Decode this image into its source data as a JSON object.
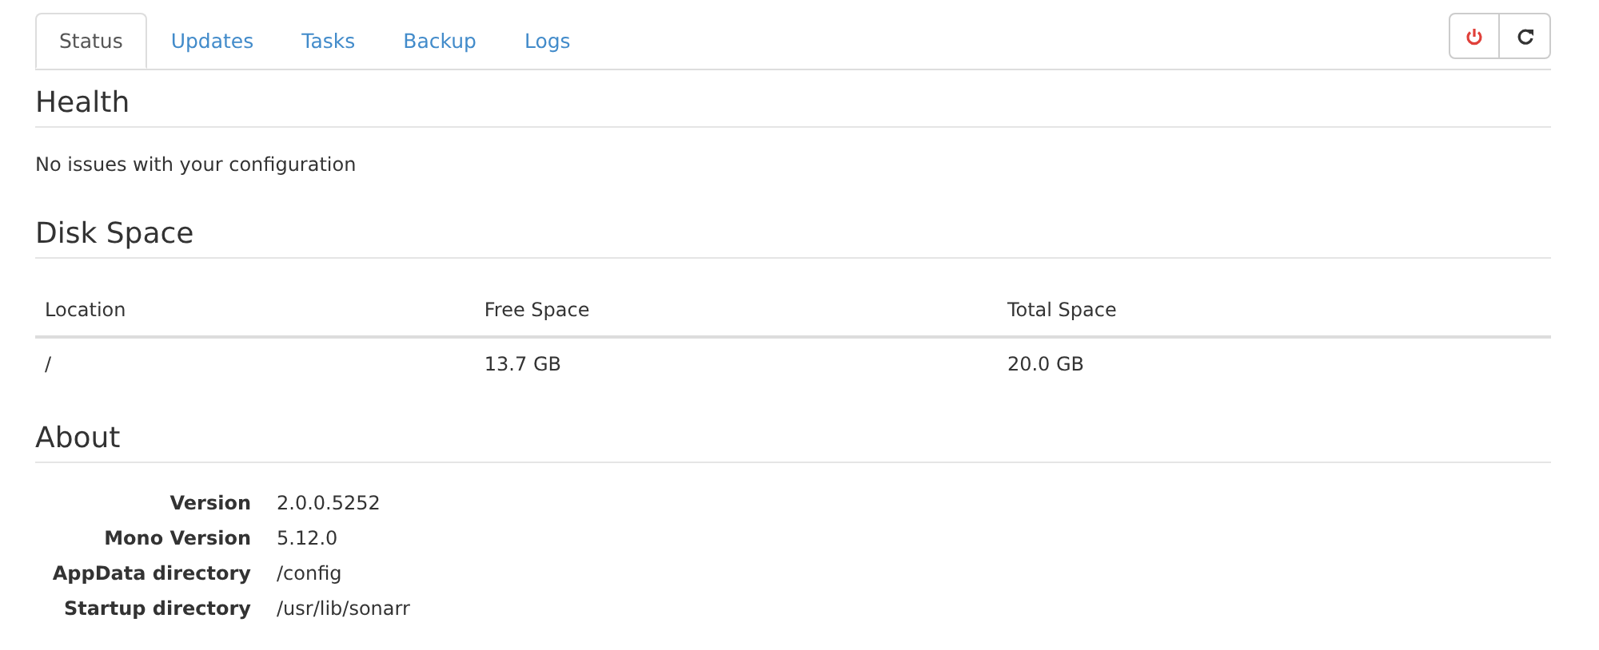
{
  "tabs": [
    {
      "label": "Status",
      "selected": true
    },
    {
      "label": "Updates",
      "selected": false
    },
    {
      "label": "Tasks",
      "selected": false
    },
    {
      "label": "Backup",
      "selected": false
    },
    {
      "label": "Logs",
      "selected": false
    }
  ],
  "toolbar": [
    {
      "kind": "power"
    },
    {
      "kind": "restart"
    }
  ],
  "health": {
    "title": "Health",
    "message": "No issues with your configuration"
  },
  "disk_space": {
    "title": "Disk Space",
    "columns": [
      "Location",
      "Free Space",
      "Total Space"
    ],
    "rows": [
      [
        "/",
        "13.7 GB",
        "20.0 GB"
      ]
    ]
  },
  "about": {
    "title": "About",
    "items": [
      {
        "label": "Version",
        "value": "2.0.0.5252"
      },
      {
        "label": "Mono Version",
        "value": "5.12.0"
      },
      {
        "label": "AppData directory",
        "value": "/config"
      },
      {
        "label": "Startup directory",
        "value": "/usr/lib/sonarr"
      }
    ]
  }
}
